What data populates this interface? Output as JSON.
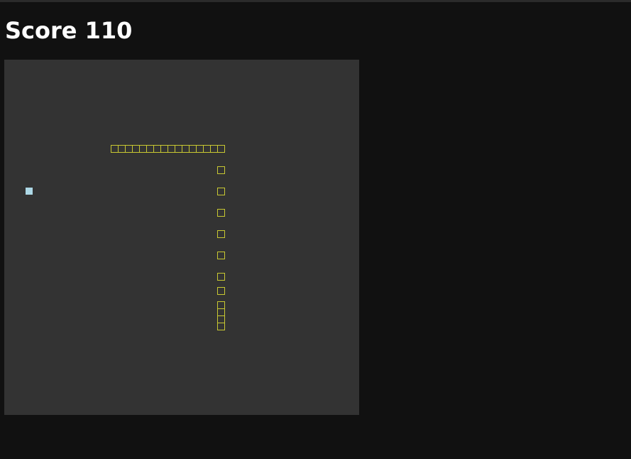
{
  "score": {
    "label": "Score",
    "value": 110,
    "text": "Score 110"
  },
  "board": {
    "grid": "50x50",
    "colors": {
      "background": "#333333",
      "snake": "#c8c832",
      "food": "#add8e6",
      "page": "#111111"
    }
  }
}
